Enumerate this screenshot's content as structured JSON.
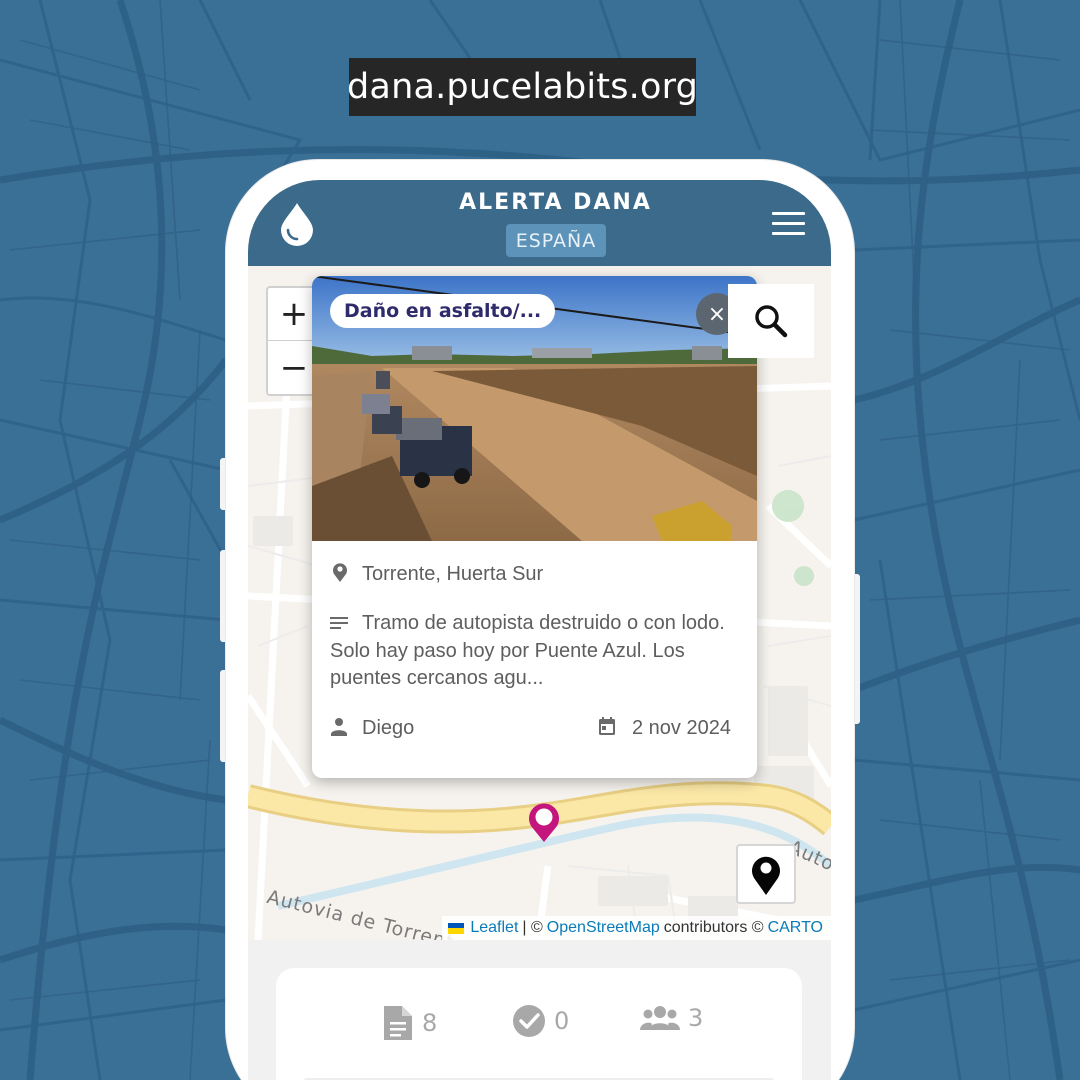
{
  "site": {
    "url": "dana.pucelabits.org"
  },
  "header": {
    "title": "ALERTA DANA",
    "badge": "ESPAÑA"
  },
  "map": {
    "zoom_in": "+",
    "zoom_out": "−",
    "road_label_main": "Autovia de Torrent",
    "road_label_edge": "Autov",
    "attribution": {
      "leaflet": "Leaflet",
      "sep1": "| ©",
      "osm": "OpenStreetMap",
      "contributors": "contributors ©",
      "carto": "CARTO"
    }
  },
  "popup": {
    "category": "Daño en asfalto/...",
    "close": "×",
    "location": "Torrente, Huerta Sur",
    "description": "Tramo de autopista destruido o con lodo. Solo hay paso hoy por Puente Azul. Los puentes cercanos agu...",
    "author": "Diego",
    "date": "2 nov 2024"
  },
  "stats": {
    "reports": "8",
    "verified": "0",
    "users": "3"
  },
  "colors": {
    "background": "#3a6f96",
    "header": "#3c6a8b",
    "badge": "#5d93b8",
    "marker": "#c4147d",
    "link": "#0a7bb8",
    "tag_text": "#2f2a6b"
  },
  "icons": [
    "water-drop-icon",
    "hamburger-menu-icon",
    "search-icon",
    "close-icon",
    "location-pin-icon",
    "notes-icon",
    "person-icon",
    "calendar-icon",
    "map-marker-icon",
    "locate-marker-icon",
    "document-icon",
    "check-circle-icon",
    "group-icon",
    "ukraine-flag-icon"
  ]
}
